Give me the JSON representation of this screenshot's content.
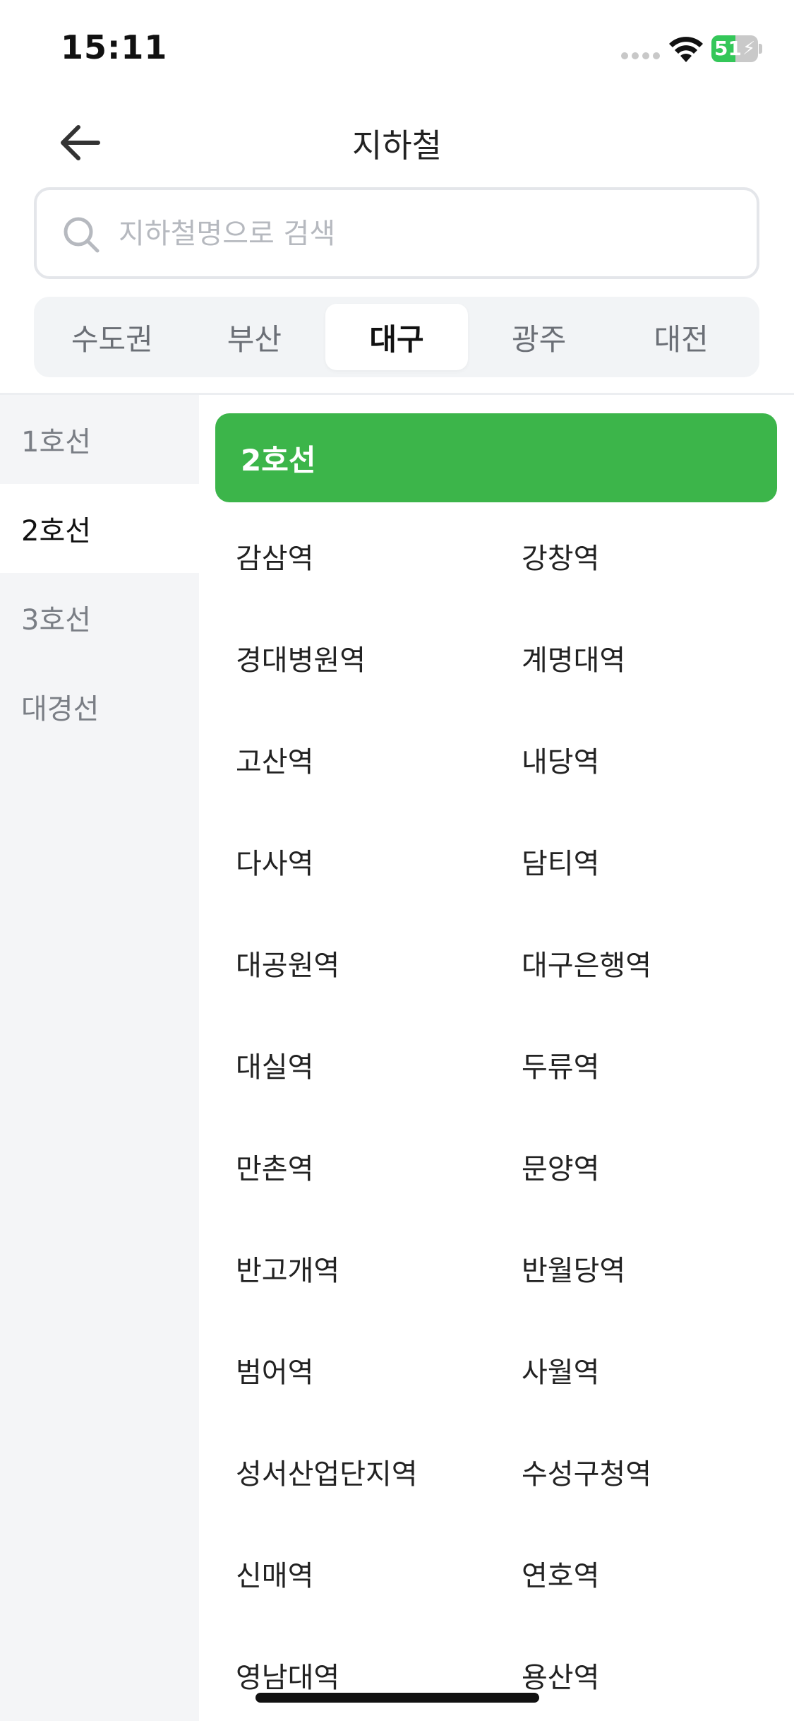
{
  "status_bar": {
    "time": "15:11",
    "battery": "51",
    "battery_level": 0.51
  },
  "header": {
    "title": "지하철"
  },
  "search": {
    "placeholder": "지하철명으로 검색",
    "value": ""
  },
  "region_tabs": [
    {
      "label": "수도권",
      "active": false
    },
    {
      "label": "부산",
      "active": false
    },
    {
      "label": "대구",
      "active": true
    },
    {
      "label": "광주",
      "active": false
    },
    {
      "label": "대전",
      "active": false
    }
  ],
  "lines": [
    {
      "label": "1호선",
      "active": false
    },
    {
      "label": "2호선",
      "active": true
    },
    {
      "label": "3호선",
      "active": false
    },
    {
      "label": "대경선",
      "active": false
    }
  ],
  "selected_line": {
    "label": "2호선",
    "color": "#3cb54a"
  },
  "stations": [
    "감삼역",
    "강창역",
    "경대병원역",
    "계명대역",
    "고산역",
    "내당역",
    "다사역",
    "담티역",
    "대공원역",
    "대구은행역",
    "대실역",
    "두류역",
    "만촌역",
    "문양역",
    "반고개역",
    "반월당역",
    "범어역",
    "사월역",
    "성서산업단지역",
    "수성구청역",
    "신매역",
    "연호역",
    "영남대역",
    "용산역"
  ]
}
